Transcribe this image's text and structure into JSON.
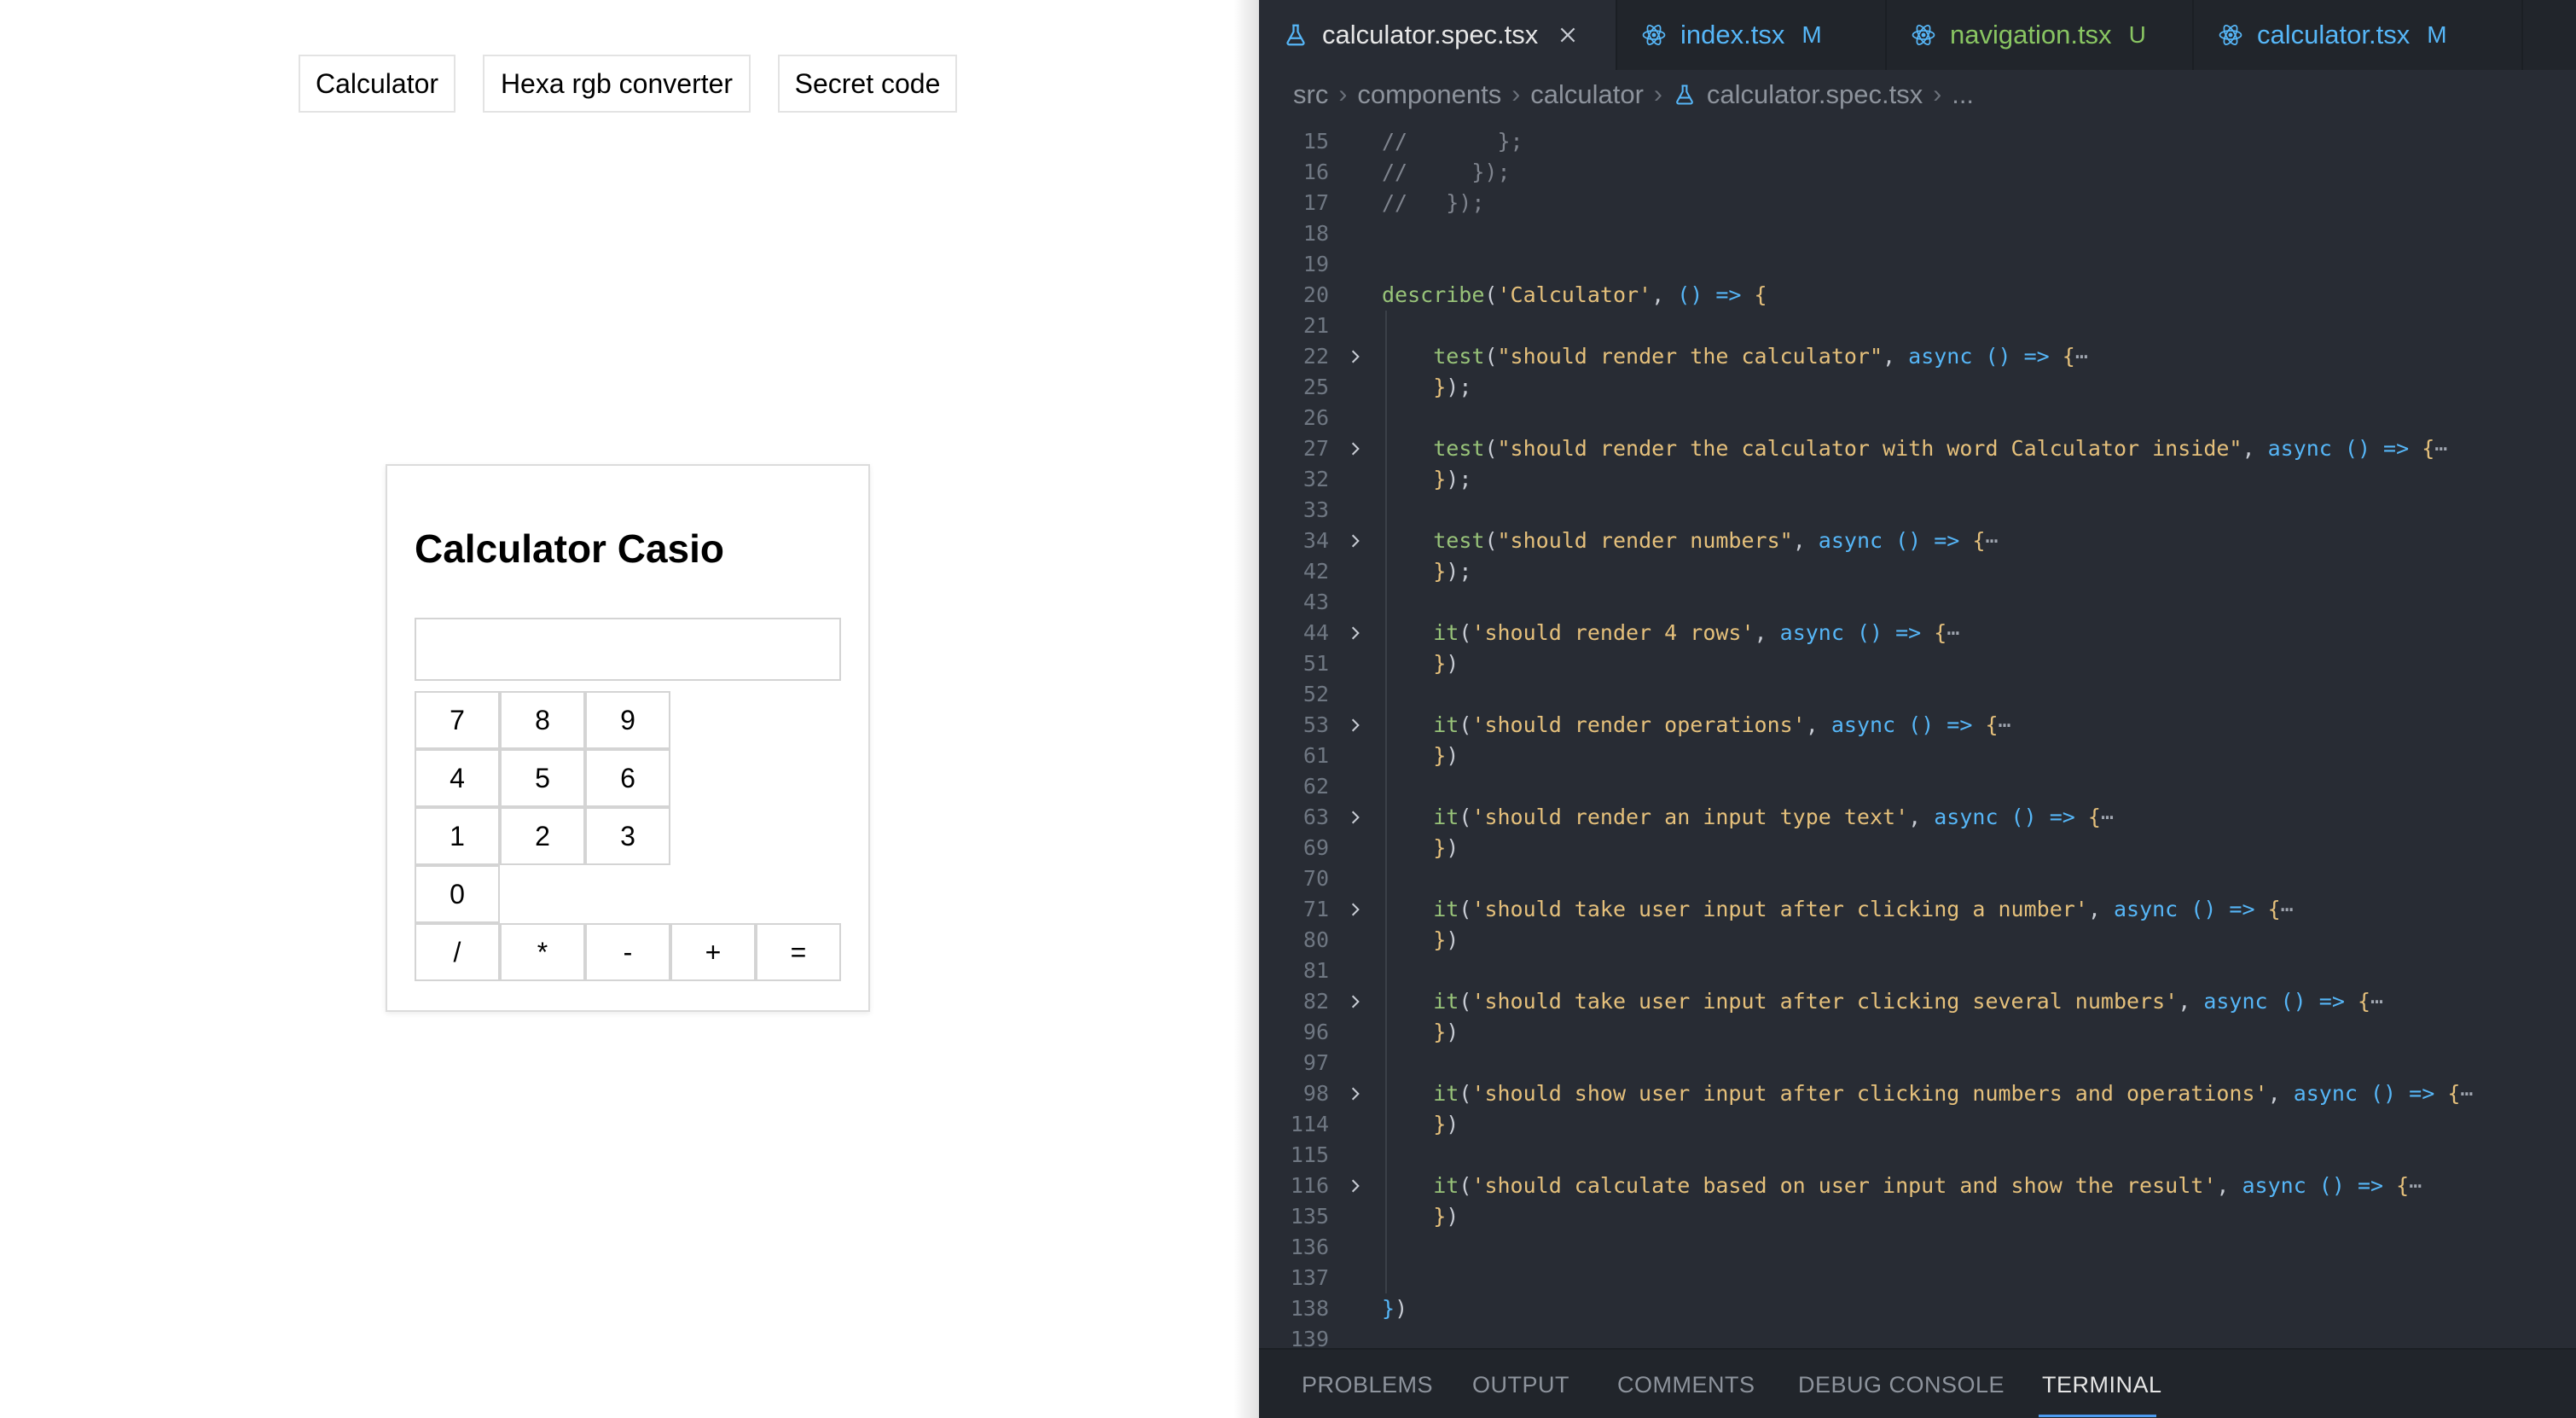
{
  "app": {
    "nav": [
      "Calculator",
      "Hexa rgb converter",
      "Secret code"
    ],
    "calculator": {
      "title": "Calculator Casio",
      "display_value": "",
      "number_rows": [
        [
          "7",
          "8",
          "9"
        ],
        [
          "4",
          "5",
          "6"
        ],
        [
          "1",
          "2",
          "3"
        ],
        [
          "0"
        ]
      ],
      "operations": [
        "/",
        "*",
        "-",
        "+",
        "="
      ]
    }
  },
  "editor": {
    "tabs": [
      {
        "label": "calculator.spec.tsx",
        "status": "",
        "icon": "flask-icon",
        "color": "#e6e6e6",
        "active": true,
        "closable": true
      },
      {
        "label": "index.tsx",
        "status": "M",
        "icon": "react-icon",
        "color": "#56b6f7",
        "active": false
      },
      {
        "label": "navigation.tsx",
        "status": "U",
        "icon": "react-icon",
        "color": "#89c562",
        "active": false
      },
      {
        "label": "calculator.tsx",
        "status": "M",
        "icon": "react-icon",
        "color": "#56b6f7",
        "active": false
      }
    ],
    "breadcrumb": [
      "src",
      "components",
      "calculator",
      "calculator.spec.tsx",
      "..."
    ],
    "lines": [
      {
        "n": "15",
        "fold": false,
        "tokens": [
          [
            "c",
            "//       };"
          ]
        ]
      },
      {
        "n": "16",
        "fold": false,
        "tokens": [
          [
            "c",
            "//     });"
          ]
        ]
      },
      {
        "n": "17",
        "fold": false,
        "tokens": [
          [
            "c",
            "//   });"
          ]
        ]
      },
      {
        "n": "18",
        "fold": false,
        "tokens": []
      },
      {
        "n": "19",
        "fold": false,
        "tokens": []
      },
      {
        "n": "20",
        "fold": false,
        "tokens": [
          [
            "f",
            "describe"
          ],
          [
            "p",
            "("
          ],
          [
            "s",
            "'Calculator'"
          ],
          [
            "p",
            ", "
          ],
          [
            "k",
            "() =>"
          ],
          [
            "p",
            " "
          ],
          [
            "b",
            "{"
          ]
        ]
      },
      {
        "n": "21",
        "fold": false,
        "tokens": []
      },
      {
        "n": "22",
        "fold": true,
        "tokens": [
          [
            "p",
            "    "
          ],
          [
            "f",
            "test"
          ],
          [
            "p",
            "("
          ],
          [
            "s",
            "\"should render the calculator\""
          ],
          [
            "p",
            ", "
          ],
          [
            "k",
            "async () =>"
          ],
          [
            "p",
            " "
          ],
          [
            "b",
            "{"
          ],
          [
            "d",
            "⋯"
          ]
        ]
      },
      {
        "n": "25",
        "fold": false,
        "tokens": [
          [
            "p",
            "    "
          ],
          [
            "b",
            "}"
          ],
          [
            "p",
            ");"
          ]
        ]
      },
      {
        "n": "26",
        "fold": false,
        "tokens": []
      },
      {
        "n": "27",
        "fold": true,
        "tokens": [
          [
            "p",
            "    "
          ],
          [
            "f",
            "test"
          ],
          [
            "p",
            "("
          ],
          [
            "s",
            "\"should render the calculator with word Calculator inside\""
          ],
          [
            "p",
            ", "
          ],
          [
            "k",
            "async () =>"
          ],
          [
            "p",
            " "
          ],
          [
            "b",
            "{"
          ],
          [
            "d",
            "⋯"
          ]
        ]
      },
      {
        "n": "32",
        "fold": false,
        "tokens": [
          [
            "p",
            "    "
          ],
          [
            "b",
            "}"
          ],
          [
            "p",
            ");"
          ]
        ]
      },
      {
        "n": "33",
        "fold": false,
        "tokens": []
      },
      {
        "n": "34",
        "fold": true,
        "tokens": [
          [
            "p",
            "    "
          ],
          [
            "f",
            "test"
          ],
          [
            "p",
            "("
          ],
          [
            "s",
            "\"should render numbers\""
          ],
          [
            "p",
            ", "
          ],
          [
            "k",
            "async () =>"
          ],
          [
            "p",
            " "
          ],
          [
            "b",
            "{"
          ],
          [
            "d",
            "⋯"
          ]
        ]
      },
      {
        "n": "42",
        "fold": false,
        "tokens": [
          [
            "p",
            "    "
          ],
          [
            "b",
            "}"
          ],
          [
            "p",
            ");"
          ]
        ]
      },
      {
        "n": "43",
        "fold": false,
        "tokens": []
      },
      {
        "n": "44",
        "fold": true,
        "tokens": [
          [
            "p",
            "    "
          ],
          [
            "f",
            "it"
          ],
          [
            "p",
            "("
          ],
          [
            "s",
            "'should render 4 rows'"
          ],
          [
            "p",
            ", "
          ],
          [
            "k",
            "async () =>"
          ],
          [
            "p",
            " "
          ],
          [
            "b",
            "{"
          ],
          [
            "d",
            "⋯"
          ]
        ]
      },
      {
        "n": "51",
        "fold": false,
        "tokens": [
          [
            "p",
            "    "
          ],
          [
            "b",
            "}"
          ],
          [
            "p",
            ")"
          ]
        ]
      },
      {
        "n": "52",
        "fold": false,
        "tokens": []
      },
      {
        "n": "53",
        "fold": true,
        "tokens": [
          [
            "p",
            "    "
          ],
          [
            "f",
            "it"
          ],
          [
            "p",
            "("
          ],
          [
            "s",
            "'should render operations'"
          ],
          [
            "p",
            ", "
          ],
          [
            "k",
            "async () =>"
          ],
          [
            "p",
            " "
          ],
          [
            "b",
            "{"
          ],
          [
            "d",
            "⋯"
          ]
        ]
      },
      {
        "n": "61",
        "fold": false,
        "tokens": [
          [
            "p",
            "    "
          ],
          [
            "b",
            "}"
          ],
          [
            "p",
            ")"
          ]
        ]
      },
      {
        "n": "62",
        "fold": false,
        "tokens": []
      },
      {
        "n": "63",
        "fold": true,
        "tokens": [
          [
            "p",
            "    "
          ],
          [
            "f",
            "it"
          ],
          [
            "p",
            "("
          ],
          [
            "s",
            "'should render an input type text'"
          ],
          [
            "p",
            ", "
          ],
          [
            "k",
            "async () =>"
          ],
          [
            "p",
            " "
          ],
          [
            "b",
            "{"
          ],
          [
            "d",
            "⋯"
          ]
        ]
      },
      {
        "n": "69",
        "fold": false,
        "tokens": [
          [
            "p",
            "    "
          ],
          [
            "b",
            "}"
          ],
          [
            "p",
            ")"
          ]
        ]
      },
      {
        "n": "70",
        "fold": false,
        "tokens": []
      },
      {
        "n": "71",
        "fold": true,
        "tokens": [
          [
            "p",
            "    "
          ],
          [
            "f",
            "it"
          ],
          [
            "p",
            "("
          ],
          [
            "s",
            "'should take user input after clicking a number'"
          ],
          [
            "p",
            ", "
          ],
          [
            "k",
            "async () =>"
          ],
          [
            "p",
            " "
          ],
          [
            "b",
            "{"
          ],
          [
            "d",
            "⋯"
          ]
        ]
      },
      {
        "n": "80",
        "fold": false,
        "tokens": [
          [
            "p",
            "    "
          ],
          [
            "b",
            "}"
          ],
          [
            "p",
            ")"
          ]
        ]
      },
      {
        "n": "81",
        "fold": false,
        "tokens": []
      },
      {
        "n": "82",
        "fold": true,
        "tokens": [
          [
            "p",
            "    "
          ],
          [
            "f",
            "it"
          ],
          [
            "p",
            "("
          ],
          [
            "s",
            "'should take user input after clicking several numbers'"
          ],
          [
            "p",
            ", "
          ],
          [
            "k",
            "async () =>"
          ],
          [
            "p",
            " "
          ],
          [
            "b",
            "{"
          ],
          [
            "d",
            "⋯"
          ]
        ]
      },
      {
        "n": "96",
        "fold": false,
        "tokens": [
          [
            "p",
            "    "
          ],
          [
            "b",
            "}"
          ],
          [
            "p",
            ")"
          ]
        ]
      },
      {
        "n": "97",
        "fold": false,
        "tokens": []
      },
      {
        "n": "98",
        "fold": true,
        "tokens": [
          [
            "p",
            "    "
          ],
          [
            "f",
            "it"
          ],
          [
            "p",
            "("
          ],
          [
            "s",
            "'should show user input after clicking numbers and operations'"
          ],
          [
            "p",
            ", "
          ],
          [
            "k",
            "async () =>"
          ],
          [
            "p",
            " "
          ],
          [
            "b",
            "{"
          ],
          [
            "d",
            "⋯"
          ]
        ]
      },
      {
        "n": "114",
        "fold": false,
        "tokens": [
          [
            "p",
            "    "
          ],
          [
            "b",
            "}"
          ],
          [
            "p",
            ")"
          ]
        ]
      },
      {
        "n": "115",
        "fold": false,
        "tokens": []
      },
      {
        "n": "116",
        "fold": true,
        "tokens": [
          [
            "p",
            "    "
          ],
          [
            "f",
            "it"
          ],
          [
            "p",
            "("
          ],
          [
            "s",
            "'should calculate based on user input and show the result'"
          ],
          [
            "p",
            ", "
          ],
          [
            "k",
            "async () =>"
          ],
          [
            "p",
            " "
          ],
          [
            "b",
            "{"
          ],
          [
            "d",
            "⋯"
          ]
        ]
      },
      {
        "n": "135",
        "fold": false,
        "tokens": [
          [
            "p",
            "    "
          ],
          [
            "b",
            "}"
          ],
          [
            "p",
            ")"
          ]
        ]
      },
      {
        "n": "136",
        "fold": false,
        "tokens": []
      },
      {
        "n": "137",
        "fold": false,
        "tokens": []
      },
      {
        "n": "138",
        "fold": false,
        "tokens": [
          [
            "b2",
            "}"
          ],
          [
            "p",
            ")"
          ]
        ]
      },
      {
        "n": "139",
        "fold": false,
        "tokens": []
      }
    ],
    "panel_tabs": [
      "PROBLEMS",
      "OUTPUT",
      "COMMENTS",
      "DEBUG CONSOLE",
      "TERMINAL"
    ],
    "active_panel": "TERMINAL",
    "colors": {
      "accent": "#4d9bf0",
      "background": "#282c34"
    }
  }
}
